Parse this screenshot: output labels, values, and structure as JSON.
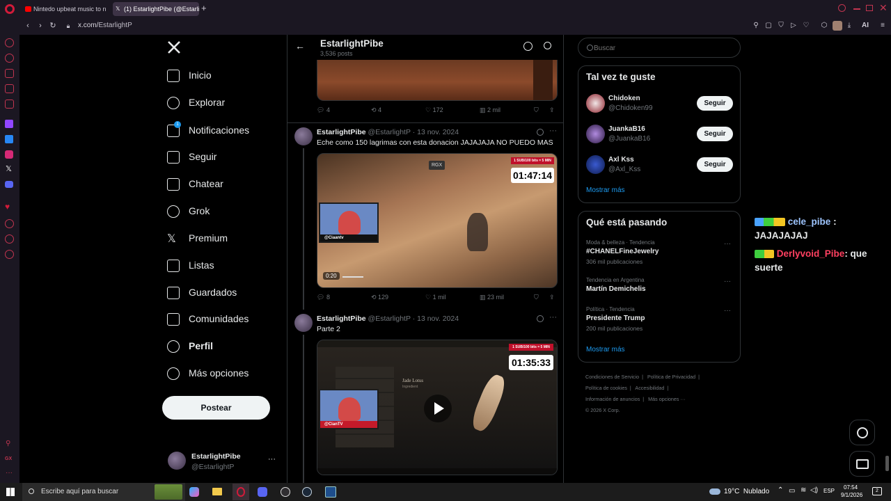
{
  "browser": {
    "tabs": [
      {
        "label": "Nintedo upbeat music to n",
        "icon": "youtube-icon",
        "color": "#ff0000"
      },
      {
        "label": "(1) EstarlightPibe (@Estarli",
        "icon": "x-icon",
        "color": "#ffffff"
      }
    ],
    "new_tab": "+",
    "url_domain": "x.com/",
    "url_path": "EstarlightP",
    "ai_label": "AI"
  },
  "nav": {
    "items": [
      {
        "label": "Inicio",
        "icon": "home-icon"
      },
      {
        "label": "Explorar",
        "icon": "search-icon"
      },
      {
        "label": "Notificaciones",
        "icon": "bell-icon",
        "badge": "1"
      },
      {
        "label": "Seguir",
        "icon": "person-add-icon"
      },
      {
        "label": "Chatear",
        "icon": "mail-icon"
      },
      {
        "label": "Grok",
        "icon": "grok-icon"
      },
      {
        "label": "Premium",
        "icon": "x-icon"
      },
      {
        "label": "Listas",
        "icon": "list-icon"
      },
      {
        "label": "Guardados",
        "icon": "bookmark-icon"
      },
      {
        "label": "Comunidades",
        "icon": "communities-icon"
      },
      {
        "label": "Perfil",
        "icon": "person-icon"
      },
      {
        "label": "Más opciones",
        "icon": "more-circle-icon"
      }
    ],
    "post_label": "Postear",
    "account_name": "EstarlightPibe",
    "account_handle": "@EstarlightP",
    "account_more": "···"
  },
  "profile_header": {
    "name": "EstarlightPibe",
    "posts": "3,536 posts"
  },
  "tweets": [
    {
      "actions": {
        "replies": "4",
        "retweets": "4",
        "likes": "172",
        "views": "2 mil"
      }
    },
    {
      "name": "EstarlightPibe",
      "handle": "@EstarlightP",
      "date": "· 13 nov. 2024",
      "text": "Eche como 150 lagrimas con esta donacion JAJAJAJA NO PUEDO MAS",
      "video": {
        "timer": "01:47:14",
        "rate": "1 SUB/100 bits = 5 MIN",
        "watermark": "RGX",
        "cam_label": "@Ciaantv",
        "time": "0:20"
      },
      "actions": {
        "replies": "8",
        "retweets": "129",
        "likes": "1 mil",
        "views": "23 mil"
      }
    },
    {
      "name": "EstarlightPibe",
      "handle": "@EstarlightP",
      "date": "· 13 nov. 2024",
      "text": "Parte 2",
      "video": {
        "timer": "01:35:33",
        "rate": "1 SUB/100 bits = 5 MIN",
        "cam_label": "@CianTV",
        "item_name": "Jade Lotus",
        "item_type": "Ingredient"
      }
    }
  ],
  "search": {
    "placeholder": "Buscar"
  },
  "who_to_follow": {
    "title": "Tal vez te guste",
    "users": [
      {
        "name": "Chidoken",
        "handle": "@Chidoken99",
        "button": "Seguir"
      },
      {
        "name": "JuankaB16",
        "handle": "@JuankaB16",
        "button": "Seguir"
      },
      {
        "name": "Axl Kss",
        "handle": "@Axl_Kss",
        "button": "Seguir"
      }
    ],
    "show_more": "Mostrar más"
  },
  "trending": {
    "title": "Qué está pasando",
    "items": [
      {
        "context": "Moda & belleza · Tendencia",
        "topic": "#CHANELFineJewelry",
        "count": "306 mil publicaciones"
      },
      {
        "context": "Tendencia en Argentina",
        "topic": "Martín Demichelis",
        "count": ""
      },
      {
        "context": "Política · Tendencia",
        "topic": "Presidente Trump",
        "count": "200 mil publicaciones"
      }
    ],
    "show_more": "Mostrar más"
  },
  "footer": {
    "links": [
      "Condiciones de Servicio",
      "Política de Privacidad",
      "Política de cookies",
      "Accesibilidad",
      "Información de anuncios",
      "Más opciones ···"
    ],
    "copyright": "© 2026 X Corp."
  },
  "chat_overlay": {
    "messages": [
      {
        "user": "cele_pibe",
        "text": "JAJAJAJAJ",
        "user_color": "#9ec5ff"
      },
      {
        "user": "Derlyvoid_Pibe",
        "text": ": que suerte",
        "user_color": "#ff4060"
      }
    ]
  },
  "taskbar": {
    "search_placeholder": "Escribe aquí para buscar",
    "weather": "19°C  Nublado",
    "lang": "ESP",
    "time": "07:54",
    "date": "9/1/2026",
    "notif": "2"
  }
}
